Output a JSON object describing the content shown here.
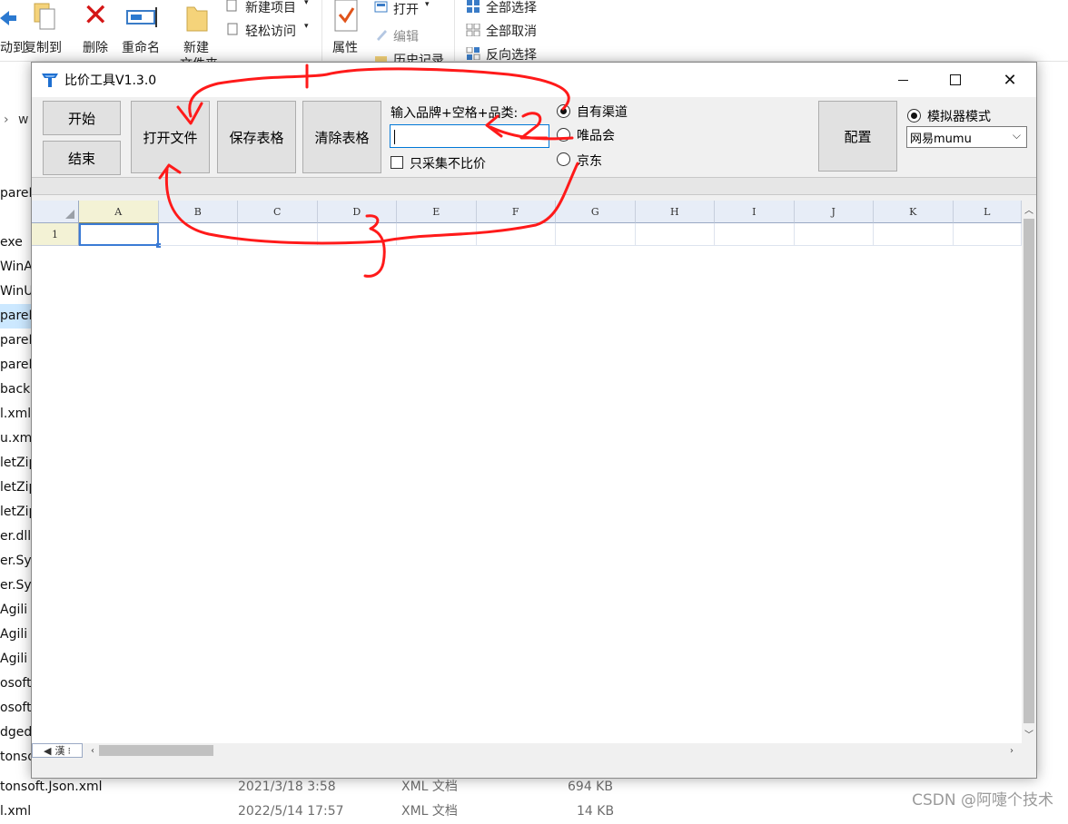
{
  "explorer": {
    "ribbon": {
      "move_to": "动到",
      "copy_to": "复制到",
      "delete": "删除",
      "rename": "重命名",
      "new_folder_l1": "新建",
      "new_folder_l2": "文件夹",
      "new_item": "新建项目",
      "easy_access": "轻松访问",
      "properties": "属性",
      "open": "打开",
      "edit": "编辑",
      "history": "历史记录",
      "select_all": "全部选择",
      "select_none": "全部取消",
      "invert_selection": "反向选择"
    },
    "address_fragment": "w",
    "file_fragments": [
      "pareF",
      "",
      "exe",
      "WinA",
      "WinU",
      "pareF",
      "pareF",
      "pareF",
      "back.",
      "l.xml",
      "u.xml",
      "letZip",
      "letZip",
      "letZip",
      "er.dll",
      "er.Sys",
      "er.Sys",
      "Agili",
      "Agili",
      "Agili",
      "osoft",
      "osoft",
      "dged",
      "tonso"
    ],
    "bottom_rows": [
      {
        "name": "tonsoft.Json.xml",
        "date": "2021/3/18 3:58",
        "type": "XML 文档",
        "size": "694 KB"
      },
      {
        "name": "l.xml",
        "date": "2022/5/14 17:57",
        "type": "XML 文档",
        "size": "14 KB"
      }
    ],
    "watermark": "CSDN @阿嚏个技术"
  },
  "app": {
    "title": "比价工具V1.3.0",
    "buttons": {
      "start": "开始",
      "stop": "结束",
      "open_file": "打开文件",
      "save_table": "保存表格",
      "clear_table": "清除表格",
      "config": "配置"
    },
    "input_label": "输入品牌+空格+品类:",
    "input_value": "",
    "only_collect_label": "只采集不比价",
    "only_collect_checked": false,
    "channels": [
      {
        "label": "自有渠道",
        "selected": true
      },
      {
        "label": "唯品会",
        "selected": false
      },
      {
        "label": "京东",
        "selected": false
      }
    ],
    "emulator_mode_label": "模拟器模式",
    "emulator_mode_selected": true,
    "emulator_value": "网易mumu",
    "grid": {
      "columns": [
        "A",
        "B",
        "C",
        "D",
        "E",
        "F",
        "G",
        "H",
        "I",
        "J",
        "K",
        "L"
      ],
      "rows": [
        "1"
      ],
      "active_cell": "A1",
      "sheet_tab": "漢"
    }
  },
  "annotations": {
    "color": "#ff1a1a",
    "labels": [
      "1",
      "2",
      "3"
    ]
  }
}
